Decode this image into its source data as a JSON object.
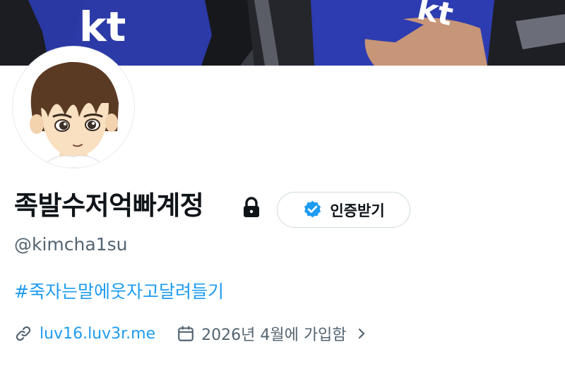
{
  "profile": {
    "display_name": "족발수저억빠계정",
    "handle": "@kimcha1su",
    "bio": "#죽자는말에웃자고달려들기",
    "website": "luv16.luv3r.me",
    "joined": "2026년 4월에 가입함",
    "verify_label": "인증받기",
    "protected": true
  },
  "banner": {
    "jersey_text": "kt",
    "jersey_color": "#2b3aa6"
  },
  "icons": {
    "lock": "lock-icon",
    "verified_badge": "verified-badge-icon",
    "link": "link-icon",
    "calendar": "calendar-icon",
    "chevron": "chevron-right-icon"
  },
  "colors": {
    "accent": "#1d9bf0",
    "text_primary": "#0f1419",
    "text_secondary": "#536471",
    "border": "#cfd9de"
  }
}
